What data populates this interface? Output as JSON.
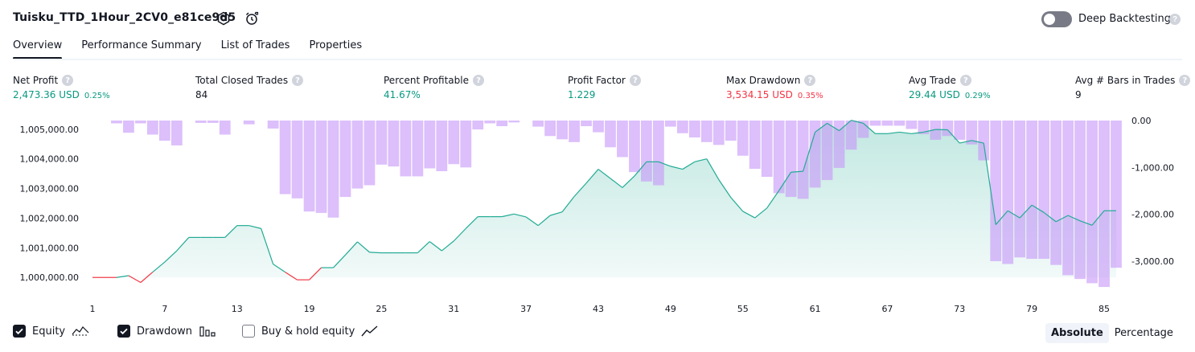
{
  "header": {
    "title": "Tuisku_TTD_1Hour_2CV0_e81ce9d5",
    "deep_backtesting_label": "Deep Backtesting",
    "deep_backtesting_on": false,
    "help_glyph": "?"
  },
  "tabs": [
    {
      "label": "Overview",
      "active": true
    },
    {
      "label": "Performance Summary",
      "active": false
    },
    {
      "label": "List of Trades",
      "active": false
    },
    {
      "label": "Properties",
      "active": false
    }
  ],
  "metrics": [
    {
      "label": "Net Profit",
      "value": "2,473.36 USD",
      "pct": "0.25%",
      "color": "green"
    },
    {
      "label": "Total Closed Trades",
      "value": "84",
      "pct": "",
      "color": "dark"
    },
    {
      "label": "Percent Profitable",
      "value": "41.67%",
      "pct": "",
      "color": "green"
    },
    {
      "label": "Profit Factor",
      "value": "1.229",
      "pct": "",
      "color": "green"
    },
    {
      "label": "Max Drawdown",
      "value": "3,534.15 USD",
      "pct": "0.35%",
      "color": "red"
    },
    {
      "label": "Avg Trade",
      "value": "29.44 USD",
      "pct": "0.29%",
      "color": "green"
    },
    {
      "label": "Avg # Bars in Trades",
      "value": "9",
      "pct": "",
      "color": "dark"
    }
  ],
  "chart_data": {
    "type": "line",
    "x_range": [
      1,
      85
    ],
    "x_ticks": [
      "1",
      "7",
      "13",
      "19",
      "25",
      "31",
      "37",
      "43",
      "49",
      "55",
      "61",
      "67",
      "73",
      "79",
      "85"
    ],
    "y_left": {
      "ticks": [
        "1,005,000.00",
        "1,004,000.00",
        "1,003,000.00",
        "1,002,000.00",
        "1,001,000.00",
        "1,000,000.00"
      ],
      "range": [
        999600,
        1005400
      ]
    },
    "y_right": {
      "ticks": [
        "0.00",
        "-1,000.00",
        "-2,000.00",
        "-3,000.00"
      ],
      "range": [
        -3600,
        0
      ]
    },
    "series": [
      {
        "name": "Equity",
        "color": "#22ab94",
        "negative_color": "#f23645",
        "values": [
          1000000,
          1000000,
          1000000,
          1000060,
          999830,
          1000180,
          1000520,
          1000900,
          1001350,
          1001350,
          1001350,
          1001350,
          1001750,
          1001750,
          1001650,
          1000450,
          1000180,
          999920,
          999920,
          1000330,
          1000330,
          1000760,
          1001200,
          1000850,
          1000830,
          1000830,
          1000830,
          1000830,
          1001210,
          1000900,
          1001230,
          1001650,
          1002050,
          1002050,
          1002050,
          1002140,
          1002040,
          1001750,
          1002090,
          1002210,
          1002730,
          1003180,
          1003650,
          1003340,
          1003030,
          1003420,
          1003900,
          1003900,
          1003750,
          1003650,
          1003900,
          1004000,
          1003300,
          1002700,
          1002230,
          1002010,
          1002340,
          1002930,
          1003550,
          1003580,
          1004900,
          1005200,
          1004950,
          1005300,
          1005200,
          1004850,
          1004850,
          1004900,
          1004850,
          1004900,
          1004990,
          1004980,
          1004530,
          1004620,
          1004530,
          1001780,
          1002250,
          1002010,
          1002440,
          1002190,
          1001880,
          1002090,
          1001910,
          1001760,
          1002250,
          1002250
        ]
      },
      {
        "name": "Drawdown",
        "color": "#c797f8",
        "values": [
          0,
          0,
          -60,
          -260,
          -60,
          -300,
          -430,
          -530,
          0,
          -50,
          -50,
          -300,
          0,
          -80,
          0,
          -170,
          -1570,
          -1660,
          -1940,
          -1970,
          -2070,
          -1630,
          -1450,
          -1380,
          -940,
          -980,
          -1190,
          -1190,
          -1020,
          -1080,
          -930,
          -1000,
          -190,
          -60,
          -120,
          -40,
          0,
          -130,
          -330,
          -400,
          -460,
          -120,
          -250,
          -570,
          -780,
          -1100,
          -1300,
          -1380,
          -130,
          -270,
          -360,
          -460,
          -520,
          -430,
          -750,
          -1030,
          -1200,
          -1550,
          -1630,
          -1670,
          -1430,
          -1270,
          -1010,
          -620,
          -370,
          -110,
          -110,
          -110,
          -180,
          -290,
          -410,
          -330,
          -410,
          -510,
          -850,
          -3000,
          -3060,
          -2920,
          -2950,
          -2950,
          -3080,
          -3300,
          -3380,
          -3470,
          -3550,
          -3140
        ]
      }
    ]
  },
  "legend": {
    "equity": {
      "label": "Equity",
      "checked": true,
      "icon": "equity-line-icon"
    },
    "drawdown": {
      "label": "Drawdown",
      "checked": true,
      "icon": "drawdown-bars-icon"
    },
    "buy_hold": {
      "label": "Buy & hold equity",
      "checked": false,
      "icon": "buy-hold-line-icon"
    }
  },
  "scale_toggle": {
    "absolute": "Absolute",
    "percentage": "Percentage",
    "selected": "absolute"
  }
}
